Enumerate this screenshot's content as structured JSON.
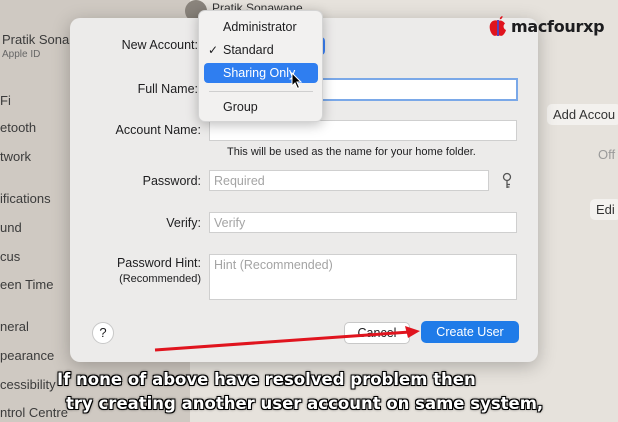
{
  "background": {
    "user_name": "Pratik Sonawane",
    "sidebar_profile_name": "Pratik Sona",
    "sidebar_profile_sub": "Apple ID",
    "sidebar_items": [
      "Fi",
      "etooth",
      "twork",
      "ifications",
      "und",
      "cus",
      "een Time",
      "neral",
      "pearance",
      "cessibility",
      "ntrol Centre"
    ],
    "add_account_label": "Add Accou",
    "off_label": "Off",
    "edit_label": "Edi"
  },
  "dialog": {
    "new_account_label": "New Account:",
    "full_name_label": "Full Name:",
    "account_name_label": "Account Name:",
    "account_name_help": "This will be used as the name for your home folder.",
    "password_label": "Password:",
    "password_placeholder": "Required",
    "verify_label": "Verify:",
    "verify_placeholder": "Verify",
    "password_hint_label": "Password Hint:",
    "password_hint_sublabel": "(Recommended)",
    "hint_placeholder": "Hint (Recommended)",
    "help_label": "?",
    "cancel_label": "Cancel",
    "create_label": "Create User"
  },
  "dropdown": {
    "items": [
      {
        "label": "Administrator",
        "checked": false,
        "highlighted": false
      },
      {
        "label": "Standard",
        "checked": true,
        "highlighted": false
      },
      {
        "label": "Sharing Only",
        "checked": false,
        "highlighted": true
      },
      {
        "label": "Group",
        "checked": false,
        "highlighted": false
      }
    ],
    "check_mark": "✓"
  },
  "logo": {
    "text": "macfourxp"
  },
  "caption": {
    "line1": "If none of above have resolved problem then",
    "line2": "try creating another user account on same system,"
  },
  "colors": {
    "accent": "#1f7be8",
    "highlight": "#2f7ef0",
    "arrow": "#e0141e"
  }
}
